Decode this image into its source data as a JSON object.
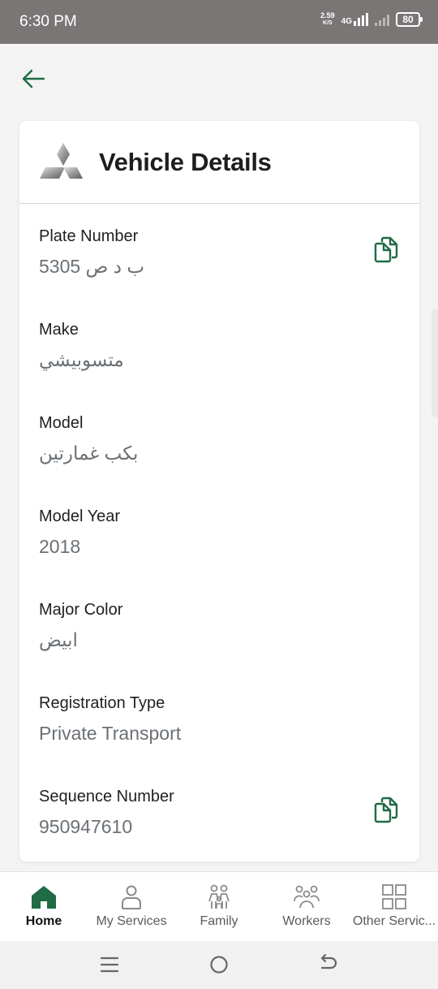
{
  "status_bar": {
    "time": "6:30 PM",
    "net_speed_value": "2.59",
    "net_speed_unit": "K/S",
    "network_type": "4G",
    "battery": "80"
  },
  "header": {
    "back_icon": "arrow-left-icon"
  },
  "card": {
    "title": "Vehicle Details",
    "logo_icon": "mitsubishi-logo",
    "fields": [
      {
        "label": "Plate Number",
        "value": "ب د ص 5305",
        "copyable": true
      },
      {
        "label": "Make",
        "value": "متسوبيشي"
      },
      {
        "label": "Model",
        "value": "بكب غمارتين"
      },
      {
        "label": "Model Year",
        "value": "2018"
      },
      {
        "label": "Major Color",
        "value": "ابيض"
      },
      {
        "label": "Registration Type",
        "value": "Private Transport"
      },
      {
        "label": "Sequence Number",
        "value": "950947610",
        "copyable": true
      }
    ]
  },
  "bottom_nav": {
    "items": [
      {
        "label": "Home",
        "icon": "home-icon",
        "active": true
      },
      {
        "label": "My Services",
        "icon": "person-icon"
      },
      {
        "label": "Family",
        "icon": "family-icon"
      },
      {
        "label": "Workers",
        "icon": "workers-icon"
      },
      {
        "label": "Other Servic...",
        "icon": "grid-icon"
      }
    ]
  },
  "colors": {
    "accent": "#1f6b45",
    "status_bar": "#7b7676",
    "text_primary": "#1f1f1f",
    "text_secondary": "#6b7075"
  }
}
